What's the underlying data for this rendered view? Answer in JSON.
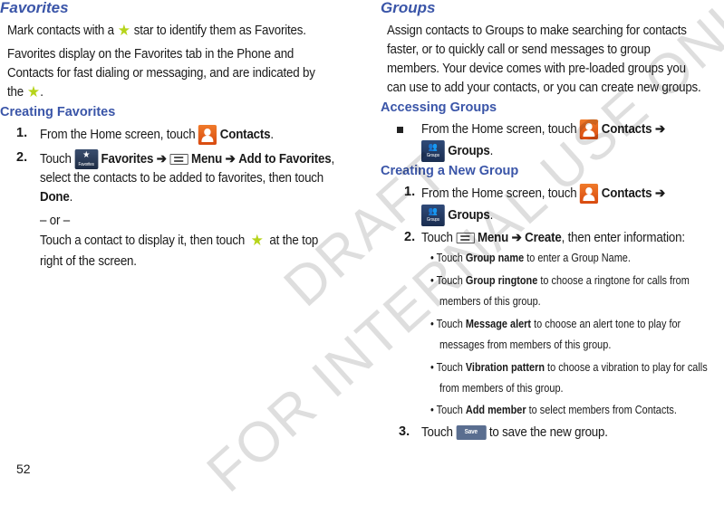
{
  "left": {
    "title": "Favorites",
    "intro1_a": "Mark contacts with a",
    "intro1_b": "star to identify them as Favorites.",
    "intro2_l1": "Favorites display on the Favorites tab in the Phone and",
    "intro2_l2": "Contacts for fast dialing or messaging, and are indicated by",
    "intro2_l3a": "the",
    "intro2_l3b": ".",
    "section": "Creating Favorites",
    "step1": {
      "num": "1.",
      "a": "From the Home screen, touch",
      "b": "Contacts",
      "c": "."
    },
    "step2": {
      "num": "2.",
      "a": "Touch",
      "b": "Favorites",
      "arrow1": "➔",
      "c": "Menu",
      "arrow2": "➔",
      "d": "Add to Favorites",
      "e": ",",
      "l2": "select the contacts to be added to favorites, then touch",
      "l3b": "Done",
      "l3c": ".",
      "or": "– or –",
      "alt_a": "Touch a contact to display it, then touch",
      "alt_b": "at the top",
      "alt_l2": "right of the screen."
    }
  },
  "right": {
    "title": "Groups",
    "intro_l1": "Assign contacts to Groups to make searching for contacts",
    "intro_l2": "faster, or to quickly call or send messages to group",
    "intro_l3": "members. Your device comes with pre-loaded groups you",
    "intro_l4": "can use to add your contacts, or you can create new groups.",
    "section1": "Accessing Groups",
    "access": {
      "a": "From the Home screen, touch",
      "b": "Contacts",
      "arrow": "➔",
      "c": "Groups",
      "d": "."
    },
    "section2": "Creating a New Group",
    "step1": {
      "num": "1.",
      "a": "From the Home screen, touch",
      "b": "Contacts",
      "arrow": "➔",
      "c": "Groups",
      "d": "."
    },
    "step2": {
      "num": "2.",
      "a": "Touch",
      "b": "Menu",
      "arrow": "➔",
      "c": "Create",
      "d": ", then enter information:"
    },
    "subitems": [
      {
        "a": "• Touch ",
        "b": "Group name",
        "c": " to enter a Group Name.",
        "l2": ""
      },
      {
        "a": "• Touch ",
        "b": "Group ringtone",
        "c": " to choose a ringtone for calls from",
        "l2": "members of this group."
      },
      {
        "a": "• Touch ",
        "b": "Message alert",
        "c": " to choose an alert tone to play for",
        "l2": "messages from members of this group."
      },
      {
        "a": "• Touch ",
        "b": "Vibration pattern",
        "c": " to choose a vibration to play for calls",
        "l2": "from members of this group."
      },
      {
        "a": "• Touch ",
        "b": "Add member",
        "c": " to select members from Contacts.",
        "l2": ""
      }
    ],
    "step3": {
      "num": "3.",
      "a": "Touch",
      "save": "Save",
      "b": "to save the new group."
    }
  },
  "icons": {
    "favtab_label": "Favorites",
    "groupstab_label": "Groups",
    "star": "★"
  },
  "page_number": "52",
  "watermark": {
    "line1": "DRAFT",
    "line2": "FOR INTERNAL USE ONLY"
  },
  "colors": {
    "heading": "#3a55a8",
    "star": "#b6d41a",
    "contacts_icon": "#e85a1a"
  }
}
